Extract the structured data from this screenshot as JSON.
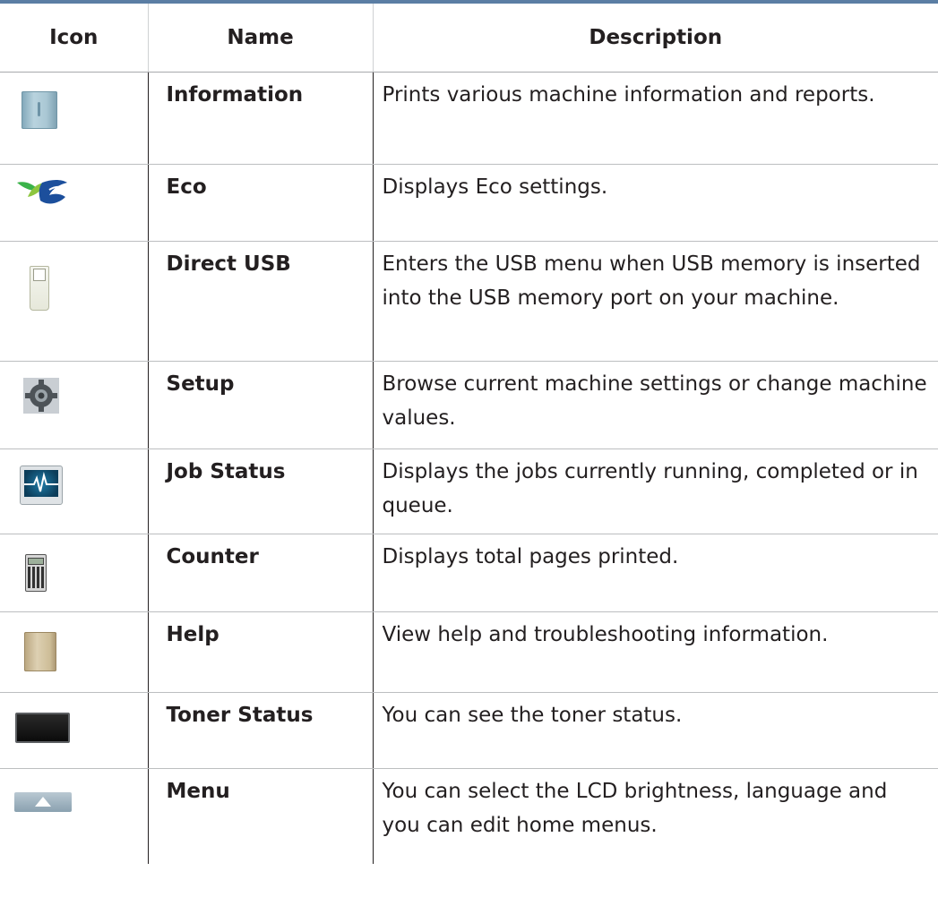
{
  "header": {
    "icon_col": "Icon",
    "name_col": "Name",
    "desc_col": "Description"
  },
  "rows": [
    {
      "icon": "information-book-icon",
      "name": "Information",
      "description": "Prints various machine information and reports."
    },
    {
      "icon": "eco-leaf-icon",
      "name": "Eco",
      "description": "Displays Eco settings."
    },
    {
      "icon": "usb-stick-icon",
      "name": "Direct USB",
      "description": "Enters the USB menu when USB memory is inserted into the USB memory port on your machine."
    },
    {
      "icon": "gear-icon",
      "name": "Setup",
      "description": "Browse current machine settings or change machine values."
    },
    {
      "icon": "monitor-pulse-icon",
      "name": "Job Status",
      "description": "Displays the jobs currently running, completed or in queue."
    },
    {
      "icon": "calculator-icon",
      "name": "Counter",
      "description": "Displays total pages printed."
    },
    {
      "icon": "help-book-icon",
      "name": "Help",
      "description": "View help and troubleshooting information."
    },
    {
      "icon": "toner-screen-icon",
      "name": "Toner Status",
      "description": "You can see the toner status."
    },
    {
      "icon": "menu-up-arrow-icon",
      "name": "Menu",
      "description": "You can select the LCD brightness, language and you can edit home menus."
    }
  ]
}
